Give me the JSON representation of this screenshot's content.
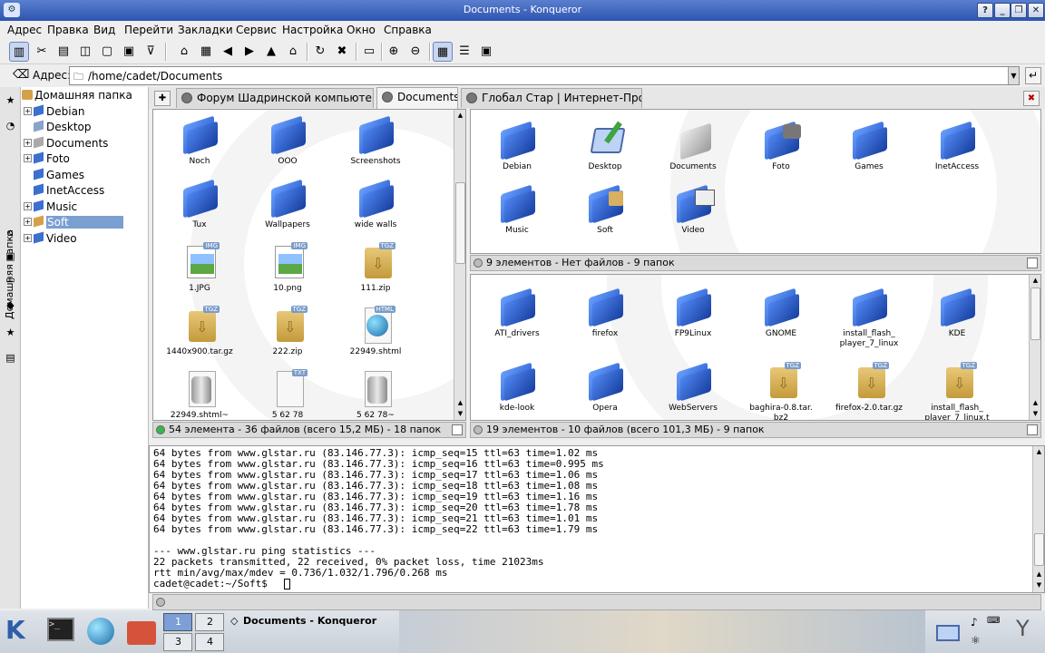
{
  "window": {
    "title": "Documents - Konqueror"
  },
  "menu": [
    "Адрес",
    "Правка",
    "Вид",
    "Перейти",
    "Закладки",
    "Сервис",
    "Настройка",
    "Окно",
    "Справка"
  ],
  "location": {
    "label": "Адрес:",
    "value": "/home/cadet/Documents"
  },
  "sidebar": {
    "tab_label": "Домашняя папка",
    "tree": [
      {
        "label": "Домашняя папка"
      },
      {
        "label": "Debian"
      },
      {
        "label": "Desktop"
      },
      {
        "label": "Documents"
      },
      {
        "label": "Foto"
      },
      {
        "label": "Games"
      },
      {
        "label": "InetAccess"
      },
      {
        "label": "Music"
      },
      {
        "label": "Soft"
      },
      {
        "label": "Video"
      }
    ]
  },
  "tabs": [
    {
      "label": "Форум Шадринской компьютерн..."
    },
    {
      "label": "Documents"
    },
    {
      "label": "Глобал Стар | Интернет-Пров..."
    }
  ],
  "left_pane": {
    "items": [
      "Noch",
      "OOO",
      "Screenshots",
      "Tux",
      "Wallpapers",
      "wide walls",
      "1.JPG",
      "10.png",
      "111.zip",
      "1440x900.tar.gz",
      "222.zip",
      "22949.shtml",
      "22949.shtml~",
      "5 62 78",
      "5 62 78~"
    ],
    "badges": {
      "img": "IMG",
      "tgz": "TGZ",
      "html": "HTML",
      "txt": "TXT"
    },
    "status": "54 элемента - 36 файлов (всего 15,2 МБ) - 18 папок"
  },
  "top_right_pane": {
    "items": [
      "Debian",
      "Desktop",
      "Documents",
      "Foto",
      "Games",
      "InetAccess",
      "Music",
      "Soft",
      "Video"
    ],
    "status": "9 элементов - Нет файлов - 9 папок"
  },
  "bottom_right_pane": {
    "items": [
      "ATI_drivers",
      "firefox",
      "FP9Linux",
      "GNOME",
      "install_flash_\nplayer_7_linux",
      "KDE",
      "kde-look",
      "Opera",
      "WebServers",
      "baghira-0.8.tar.\nbz2",
      "firefox-2.0.tar.gz",
      "install_flash_\nplayer_7_linux.t"
    ],
    "status": "19 элементов - 10 файлов (всего 101,3 МБ) - 9 папок"
  },
  "terminal": {
    "lines": [
      "64 bytes from www.glstar.ru (83.146.77.3): icmp_seq=15 ttl=63 time=1.02 ms",
      "64 bytes from www.glstar.ru (83.146.77.3): icmp_seq=16 ttl=63 time=0.995 ms",
      "64 bytes from www.glstar.ru (83.146.77.3): icmp_seq=17 ttl=63 time=1.06 ms",
      "64 bytes from www.glstar.ru (83.146.77.3): icmp_seq=18 ttl=63 time=1.08 ms",
      "64 bytes from www.glstar.ru (83.146.77.3): icmp_seq=19 ttl=63 time=1.16 ms",
      "64 bytes from www.glstar.ru (83.146.77.3): icmp_seq=20 ttl=63 time=1.78 ms",
      "64 bytes from www.glstar.ru (83.146.77.3): icmp_seq=21 ttl=63 time=1.01 ms",
      "64 bytes from www.glstar.ru (83.146.77.3): icmp_seq=22 ttl=63 time=1.79 ms",
      "",
      "--- www.glstar.ru ping statistics ---",
      "22 packets transmitted, 22 received, 0% packet loss, time 21023ms",
      "rtt min/avg/max/mdev = 0.736/1.032/1.796/0.268 ms",
      "cadet@cadet:~/Soft$ "
    ]
  },
  "taskbar": {
    "task_title": "Documents - Konqueror",
    "desktops": [
      "1",
      "2",
      "3",
      "4"
    ]
  }
}
